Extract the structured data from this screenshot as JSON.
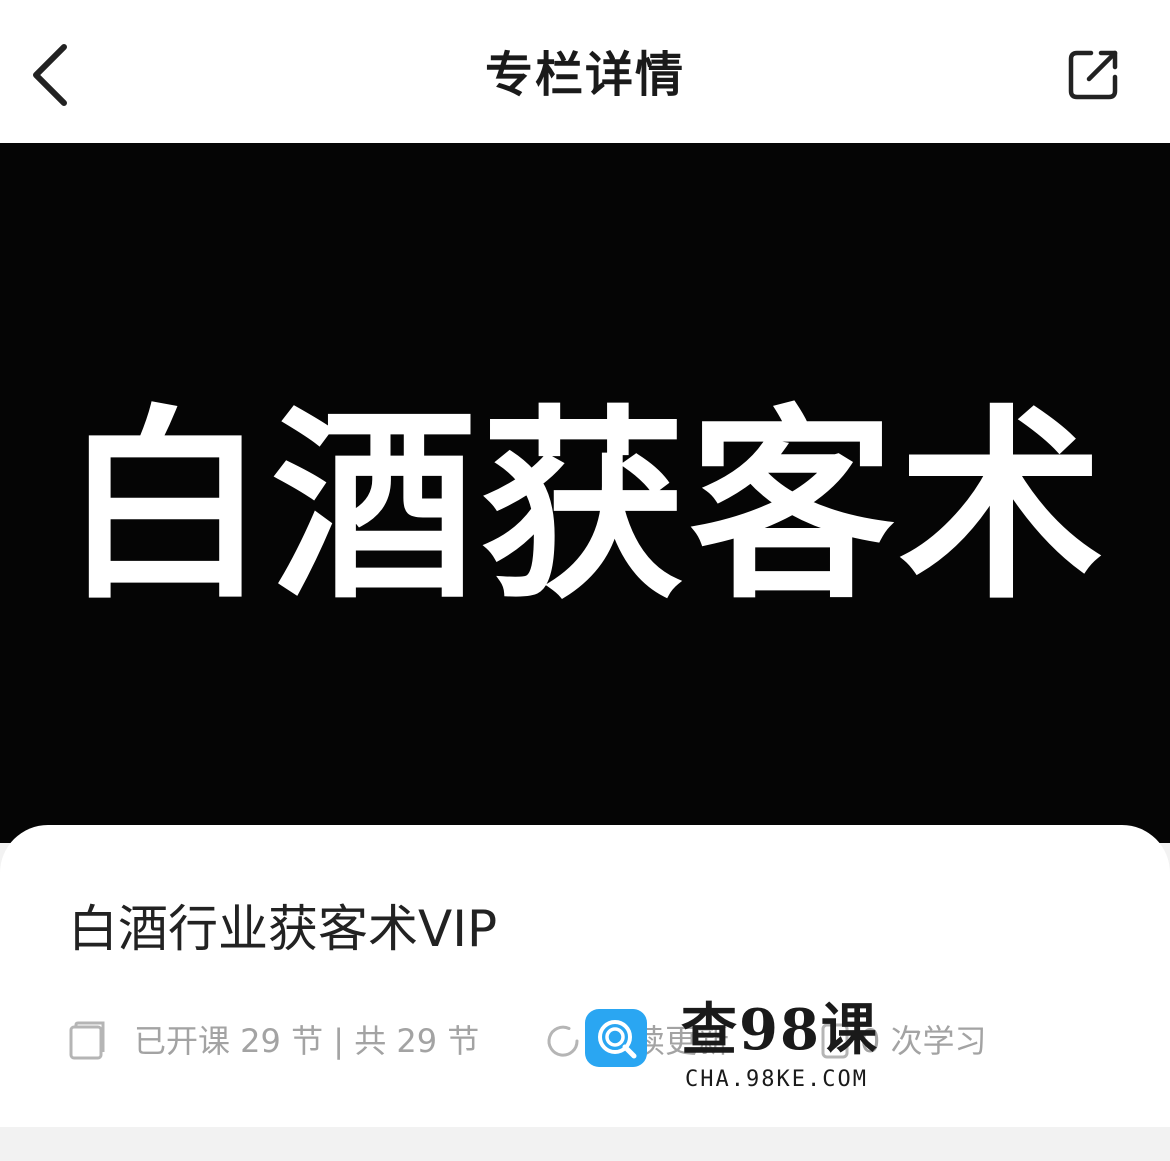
{
  "header": {
    "title": "专栏详情",
    "back_icon": "chevron-left-icon",
    "share_icon": "share-external-icon"
  },
  "banner": {
    "text": "白酒获客术",
    "background_color": "#050505"
  },
  "course": {
    "title": "白酒行业获客术VIP",
    "lessons_text": "已开课 29 节 | 共 29 节",
    "update_text": "持续更新",
    "learners_text": "0 次学习"
  },
  "watermark": {
    "main": "查98课",
    "sub": "CHA.98KE.COM"
  }
}
